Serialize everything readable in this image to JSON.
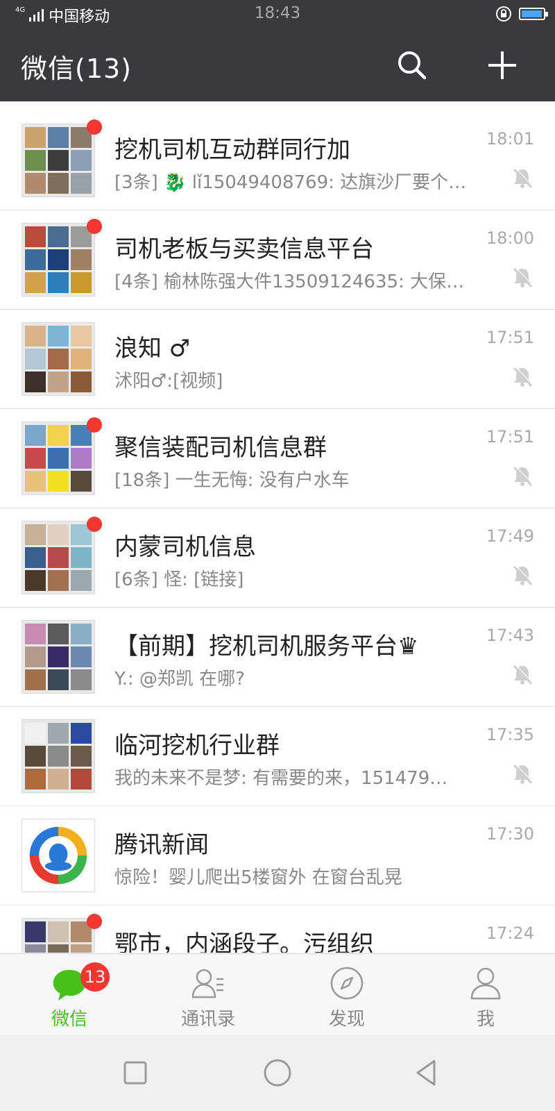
{
  "status_bar": {
    "network_tag": "4G",
    "carrier": "中国移动",
    "time": "18:43",
    "battery_color": "#4aa3ff",
    "battery_level": 0.95
  },
  "app_bar": {
    "title": "微信(13)",
    "icons": [
      "search-icon",
      "plus-icon"
    ]
  },
  "chats": [
    {
      "name": "挖机司机互动群同行加",
      "preview": "[3条] 🐉 lǐ15049408769: 达旗沙厂要个…",
      "time": "18:01",
      "unread_dot": true,
      "muted": true,
      "avatar_colors": [
        "#c9a36b",
        "#5c7fa5",
        "#8c7b6a",
        "#6b8f4e",
        "#3d3d3d",
        "#8aa0b4",
        "#b08a6a",
        "#7f6f5a",
        "#9aa0a8"
      ]
    },
    {
      "name": "司机老板与买卖信息平台",
      "preview": "[4条] 榆林陈强大件13509124635: 大保…",
      "time": "18:00",
      "unread_dot": true,
      "muted": true,
      "avatar_colors": [
        "#b84a3a",
        "#4a6c8f",
        "#9b9b9b",
        "#3f6b9a",
        "#1c3f75",
        "#a08060",
        "#d2a24a",
        "#2c7fb8",
        "#c79a2b"
      ]
    },
    {
      "name": "浪知 ♂",
      "preview": "沭阳♂:[视频]",
      "time": "17:51",
      "unread_dot": false,
      "muted": true,
      "avatar_colors": [
        "#d9b38c",
        "#7fb6d6",
        "#e8c6a0",
        "#b3c7d6",
        "#a36a4a",
        "#e0b27a",
        "#3b2f2a",
        "#c1a38a",
        "#8a5a3b"
      ]
    },
    {
      "name": "聚信装配司机信息群",
      "preview": "[18条] 一生无悔: 没有户水车",
      "time": "17:51",
      "unread_dot": true,
      "muted": true,
      "avatar_colors": [
        "#7aa7c7",
        "#f2d24a",
        "#4a7fb8",
        "#c84a4a",
        "#3d6fb0",
        "#b07ac8",
        "#e6c17a",
        "#f0e020",
        "#5a4a3a"
      ]
    },
    {
      "name": "内蒙司机信息",
      "preview": "[6条] 怪: [链接]",
      "time": "17:49",
      "unread_dot": true,
      "muted": true,
      "avatar_colors": [
        "#c7b09a",
        "#e0d0c0",
        "#9ec7d6",
        "#3a5f8f",
        "#b84a4a",
        "#7fb6c7",
        "#4a3a2a",
        "#a07050",
        "#9aa8b0"
      ]
    },
    {
      "name": "【前期】挖机司机服务平台♛",
      "preview": "Y.: @郑凯 在哪?",
      "time": "17:43",
      "unread_dot": false,
      "muted": true,
      "avatar_colors": [
        "#c78ab0",
        "#5a5a5a",
        "#8ab0c7",
        "#b09a8a",
        "#3a2a6a",
        "#6a8ab0",
        "#a0704a",
        "#3a4a5a",
        "#8a8a8a"
      ]
    },
    {
      "name": "临河挖机行业群",
      "preview": "我的未来不是梦: 有需要的来，151479…",
      "time": "17:35",
      "unread_dot": false,
      "muted": true,
      "avatar_colors": [
        "#f0f0f0",
        "#a0a8b0",
        "#2a4aa0",
        "#5a4a3a",
        "#8a8a8a",
        "#6a5a4a",
        "#b06a3a",
        "#d0b090",
        "#b04a3a"
      ]
    },
    {
      "name": "腾讯新闻",
      "preview": "惊险！婴儿爬出5楼窗外 在窗台乱晃",
      "time": "17:30",
      "unread_dot": false,
      "muted": false,
      "avatar_type": "logo"
    },
    {
      "name": "鄂市，内涵段子。污组织",
      "preview": "",
      "time": "17:24",
      "unread_dot": true,
      "muted": false,
      "avatar_colors": [
        "#3a3a6a",
        "#d0c0b0",
        "#b08a6a",
        "#8a8a9a",
        "#7a6a5a",
        "#c0a080",
        "#5a6a7a",
        "#a0a0a0",
        "#6a5a4a"
      ]
    }
  ],
  "tabs": [
    {
      "label": "微信",
      "icon": "chat-bubble-icon",
      "active": true,
      "badge": "13"
    },
    {
      "label": "通讯录",
      "icon": "contacts-icon",
      "active": false
    },
    {
      "label": "发现",
      "icon": "compass-icon",
      "active": false
    },
    {
      "label": "我",
      "icon": "person-icon",
      "active": false
    }
  ],
  "colors": {
    "header_bg": "#393a3f",
    "accent_green": "#46c01b",
    "badge_red": "#f43530"
  }
}
